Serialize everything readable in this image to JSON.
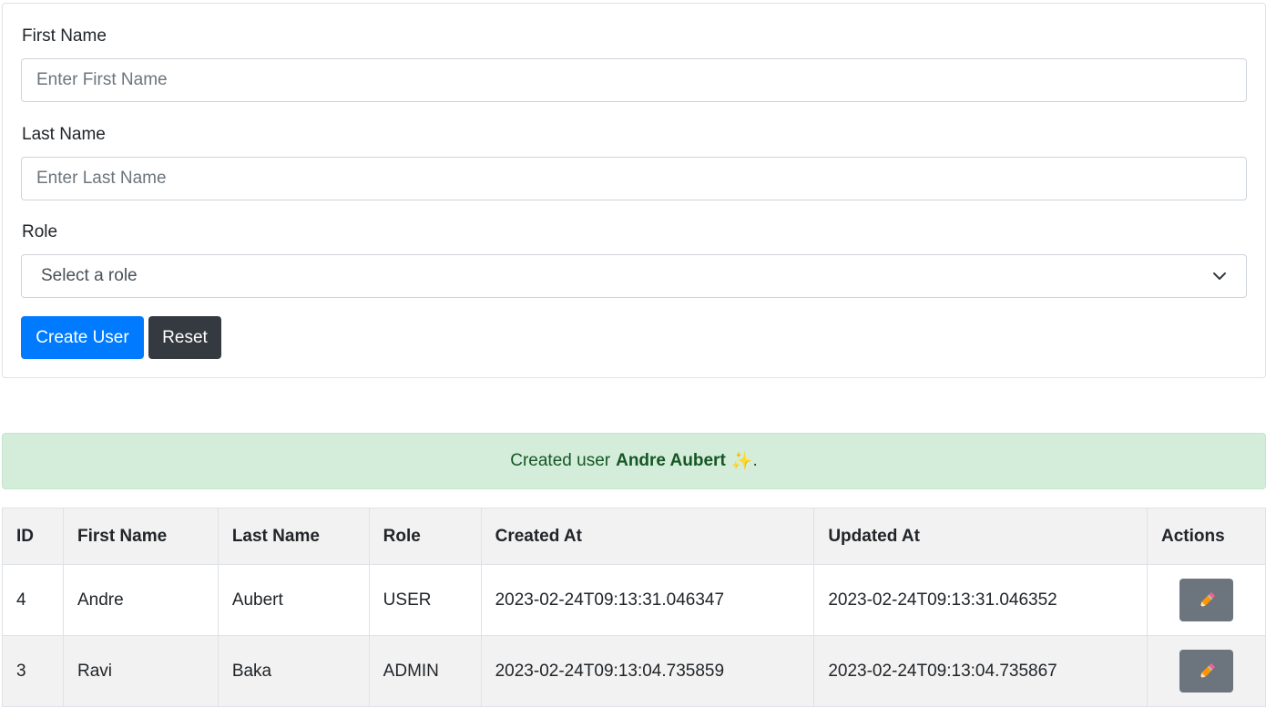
{
  "form": {
    "first_name_label": "First Name",
    "first_name_placeholder": "Enter First Name",
    "last_name_label": "Last Name",
    "last_name_placeholder": "Enter Last Name",
    "role_label": "Role",
    "role_selected": "Select a role",
    "create_button": "Create User",
    "reset_button": "Reset"
  },
  "alert": {
    "prefix": "Created user",
    "name": "Andre Aubert",
    "emoji": "✨",
    "suffix": "."
  },
  "table": {
    "headers": [
      "ID",
      "First Name",
      "Last Name",
      "Role",
      "Created At",
      "Updated At",
      "Actions"
    ],
    "rows": [
      {
        "id": "4",
        "first": "Andre",
        "last": "Aubert",
        "role": "USER",
        "created": "2023-02-24T09:13:31.046347",
        "updated": "2023-02-24T09:13:31.046352",
        "action_icon": "pencil-icon"
      },
      {
        "id": "3",
        "first": "Ravi",
        "last": "Baka",
        "role": "ADMIN",
        "created": "2023-02-24T09:13:04.735859",
        "updated": "2023-02-24T09:13:04.735867",
        "action_icon": "pencil-icon"
      }
    ]
  },
  "colors": {
    "primary": "#007bff",
    "dark": "#343a40",
    "secondary": "#6c757d",
    "success_bg": "#d4edda",
    "success_text": "#155724"
  }
}
